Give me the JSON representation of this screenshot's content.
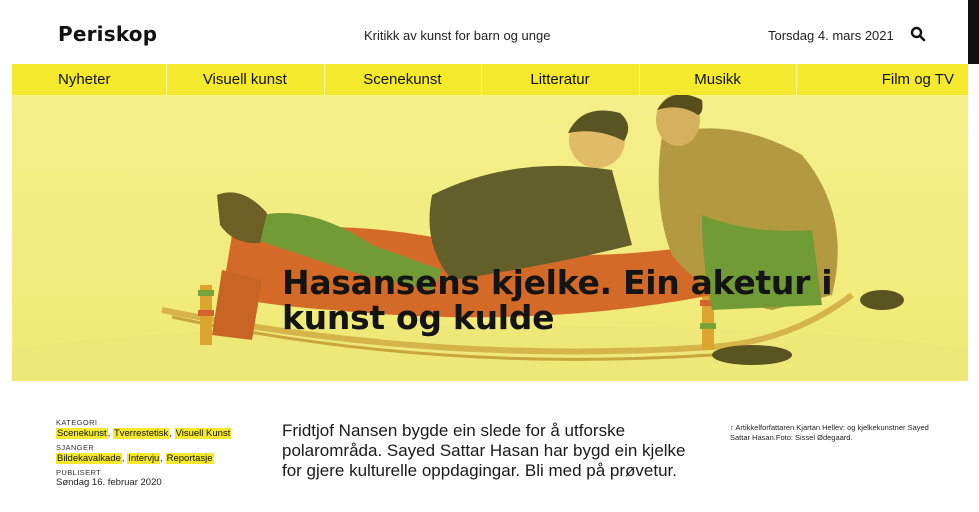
{
  "header": {
    "logo": "Periskop",
    "tagline": "Kritikk av kunst for barn og unge",
    "date": "Torsdag 4. mars 2021",
    "search_icon": "search-icon"
  },
  "nav": {
    "items": [
      "Nyheter",
      "Visuell kunst",
      "Scenekunst",
      "Litteratur",
      "Musikk",
      "Film og TV"
    ]
  },
  "colors": {
    "accent": "#f4e92c",
    "text": "#111111"
  },
  "hero": {
    "title": "Hasansens kjelke. Ein aketur i kunst og kulde"
  },
  "meta": {
    "kategori_label": "KATEGORI",
    "kategori": [
      "Scenekunst",
      "Tverrestetisk",
      "Visuell Kunst"
    ],
    "sjanger_label": "SJANGER",
    "sjanger": [
      "Bildekavalkade",
      "Intervju",
      "Reportasje"
    ],
    "publisert_label": "PUBLISERT",
    "publisert": "Søndag 16. februar 2020"
  },
  "lead": "Fridtjof Nansen bygde ein slede for å utforske polarområda. Sayed Sattar Hasan har bygd ein kjelke for gjere kulturelle oppdagingar. Bli med på prøvetur.",
  "caption": "↑ Artikkelforfattaren Kjartan Hellev: og kjelkekunstner Sayed Sattar Hasan.Foto: Sissel Ødegaard."
}
